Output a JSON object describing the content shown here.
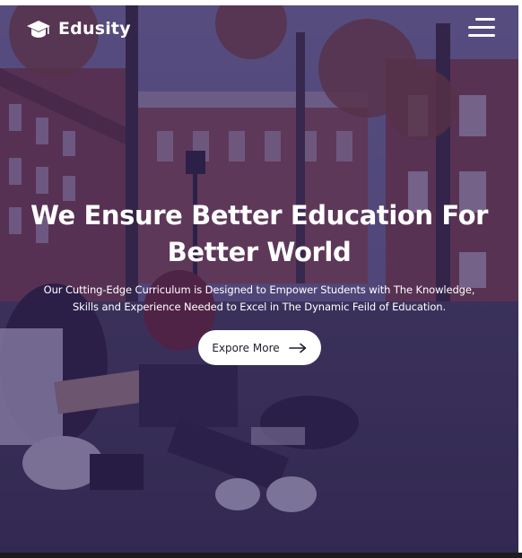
{
  "header": {
    "logo_text": "Edusity",
    "logo_icon": "graduation-cap-icon",
    "menu_icon": "hamburger-menu-icon"
  },
  "hero": {
    "title_line_1": "We Ensure Better Education For",
    "title_line_2": "Better World",
    "subtitle_line_1": "Our Cutting-Edge Curriculum is Designed to Empower Students with The Knowledge,",
    "subtitle_line_2": "Skills and Experience Needed to Excel in The Dynamic Feild of Education.",
    "cta_label": "Expore More",
    "cta_icon": "arrow-right-icon"
  },
  "colors": {
    "overlay": "#2c1e5c",
    "text": "#ffffff",
    "button_bg": "#ffffff",
    "button_text": "#1f1f2e"
  }
}
